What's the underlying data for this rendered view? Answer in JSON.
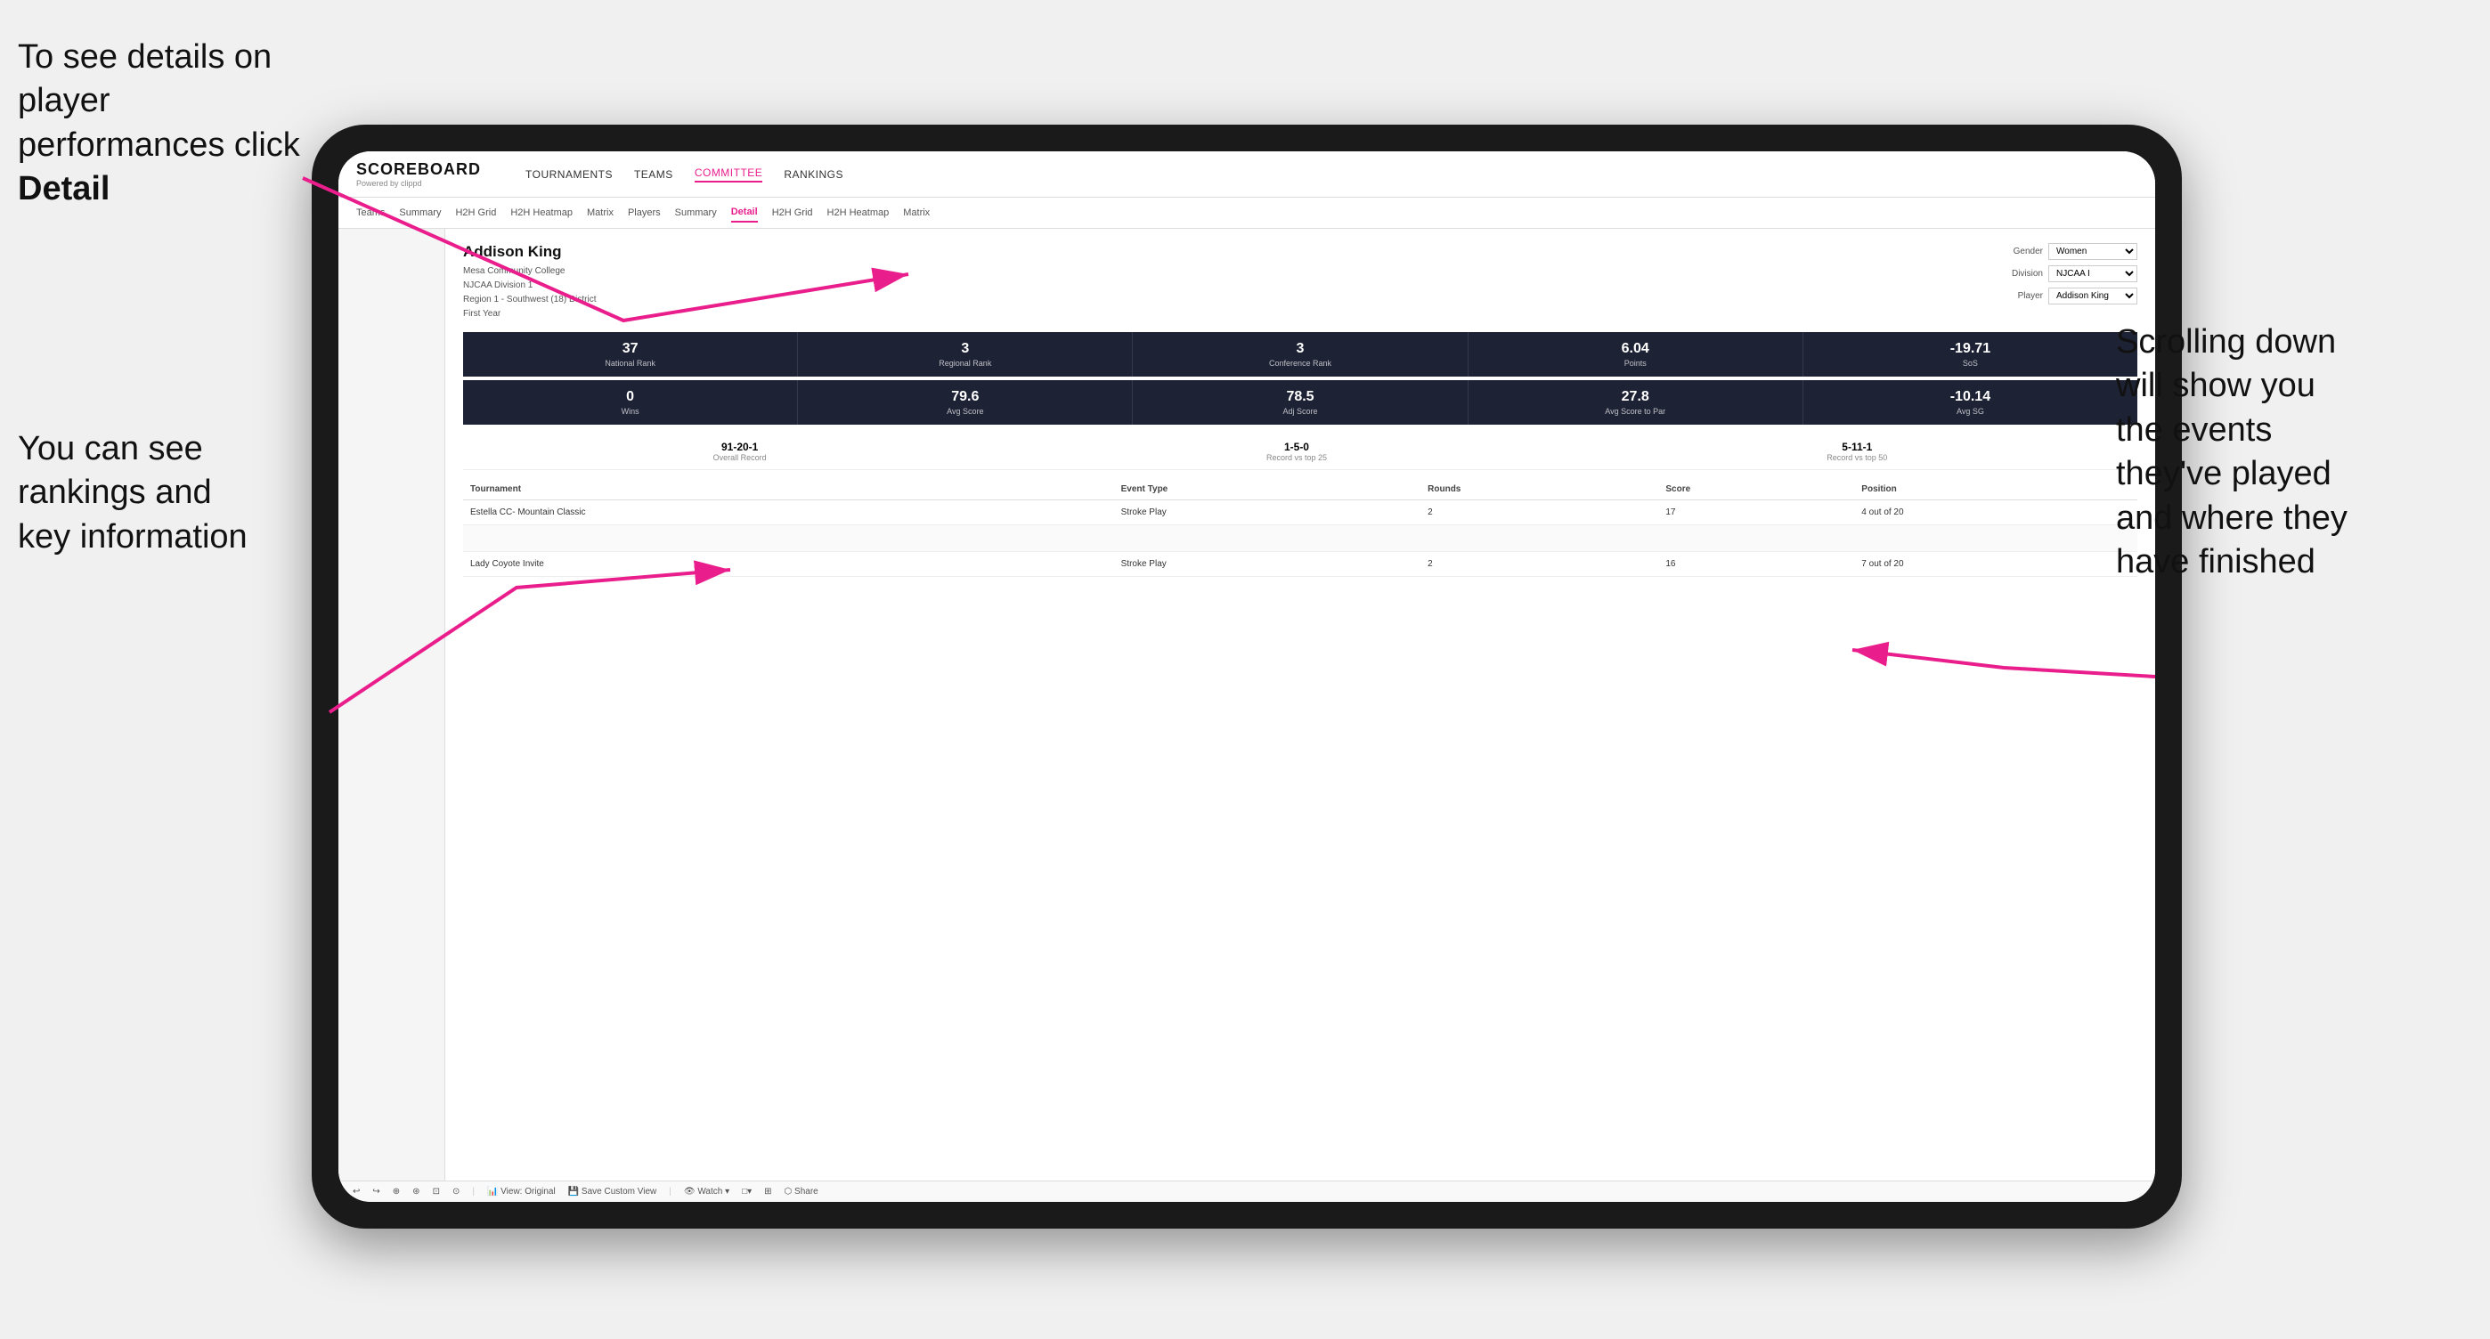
{
  "annotations": {
    "top_left": "To see details on player performances click Detail",
    "bottom_left_line1": "You can see",
    "bottom_left_line2": "rankings and",
    "bottom_left_line3": "key information",
    "right_line1": "Scrolling down",
    "right_line2": "will show you",
    "right_line3": "the events",
    "right_line4": "they've played",
    "right_line5": "and where they",
    "right_line6": "have finished"
  },
  "nav": {
    "logo": "SCOREBOARD",
    "logo_sub": "Powered by clippd",
    "items": [
      "TOURNAMENTS",
      "TEAMS",
      "COMMITTEE",
      "RANKINGS"
    ],
    "active": "COMMITTEE"
  },
  "sub_nav": {
    "items": [
      "Teams",
      "Summary",
      "H2H Grid",
      "H2H Heatmap",
      "Matrix",
      "Players",
      "Summary",
      "Detail",
      "H2H Grid",
      "H2H Heatmap",
      "Matrix"
    ],
    "active": "Detail"
  },
  "player": {
    "name": "Addison King",
    "school": "Mesa Community College",
    "division": "NJCAA Division 1",
    "region": "Region 1 - Southwest (18) District",
    "year": "First Year"
  },
  "filters": {
    "gender_label": "Gender",
    "gender_value": "Women",
    "division_label": "Division",
    "division_value": "NJCAA I",
    "player_label": "Player",
    "player_value": "Addison King"
  },
  "stats_row1": [
    {
      "value": "37",
      "label": "National Rank"
    },
    {
      "value": "3",
      "label": "Regional Rank"
    },
    {
      "value": "3",
      "label": "Conference Rank"
    },
    {
      "value": "6.04",
      "label": "Points"
    },
    {
      "value": "-19.71",
      "label": "SoS"
    }
  ],
  "stats_row2": [
    {
      "value": "0",
      "label": "Wins"
    },
    {
      "value": "79.6",
      "label": "Avg Score"
    },
    {
      "value": "78.5",
      "label": "Adj Score"
    },
    {
      "value": "27.8",
      "label": "Avg Score to Par"
    },
    {
      "value": "-10.14",
      "label": "Avg SG"
    }
  ],
  "records": [
    {
      "value": "91-20-1",
      "label": "Overall Record"
    },
    {
      "value": "1-5-0",
      "label": "Record vs top 25"
    },
    {
      "value": "5-11-1",
      "label": "Record vs top 50"
    }
  ],
  "table": {
    "headers": [
      "Tournament",
      "Event Type",
      "Rounds",
      "Score",
      "Position"
    ],
    "rows": [
      {
        "tournament": "Estella CC- Mountain Classic",
        "event_type": "Stroke Play",
        "rounds": "2",
        "score": "17",
        "position": "4 out of 20"
      },
      {
        "tournament": "",
        "event_type": "",
        "rounds": "",
        "score": "",
        "position": ""
      },
      {
        "tournament": "Lady Coyote Invite",
        "event_type": "Stroke Play",
        "rounds": "2",
        "score": "16",
        "position": "7 out of 20"
      }
    ]
  },
  "toolbar": {
    "items": [
      "↩",
      "↪",
      "⊕",
      "⊛",
      "⊡-⊢",
      "⊙",
      "View: Original",
      "Save Custom View",
      "Watch ▾",
      "□▾",
      "⊞",
      "Share"
    ]
  }
}
